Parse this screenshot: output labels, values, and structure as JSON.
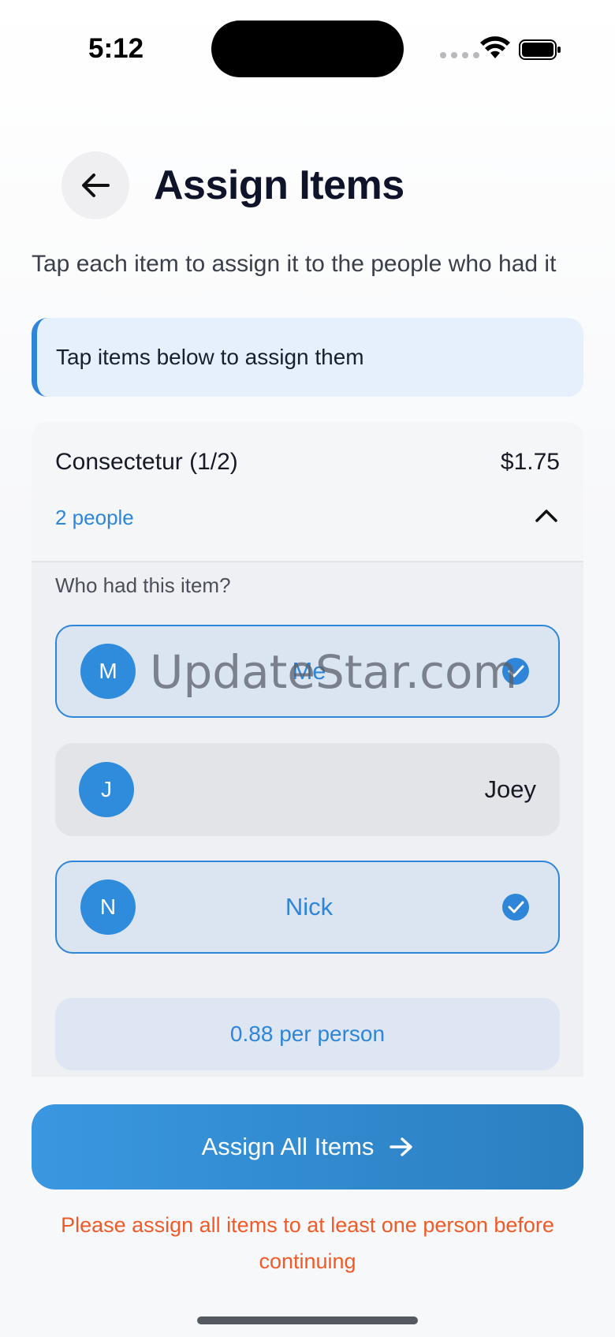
{
  "status_bar": {
    "time": "5:12"
  },
  "header": {
    "title": "Assign Items",
    "subtitle": "Tap each item to assign it to the people who had it"
  },
  "hint": {
    "text": "Tap items below to assign them"
  },
  "item": {
    "name": "Consectetur (1/2)",
    "price": "$1.75",
    "people_count": "2 people",
    "question": "Who had this item?",
    "people": [
      {
        "initial": "M",
        "name": "Me",
        "selected": true
      },
      {
        "initial": "J",
        "name": "Joey",
        "selected": false
      },
      {
        "initial": "N",
        "name": "Nick",
        "selected": true
      }
    ],
    "per_person": "0.88 per person"
  },
  "watermark": "UpdateStar.com",
  "actions": {
    "assign_all_label": "Assign All Items"
  },
  "error": {
    "message": "Please assign all items to at least one person before continuing"
  },
  "colors": {
    "accent": "#2f86d8",
    "error": "#f05a28",
    "hint_bg": "#e5f0fc"
  }
}
